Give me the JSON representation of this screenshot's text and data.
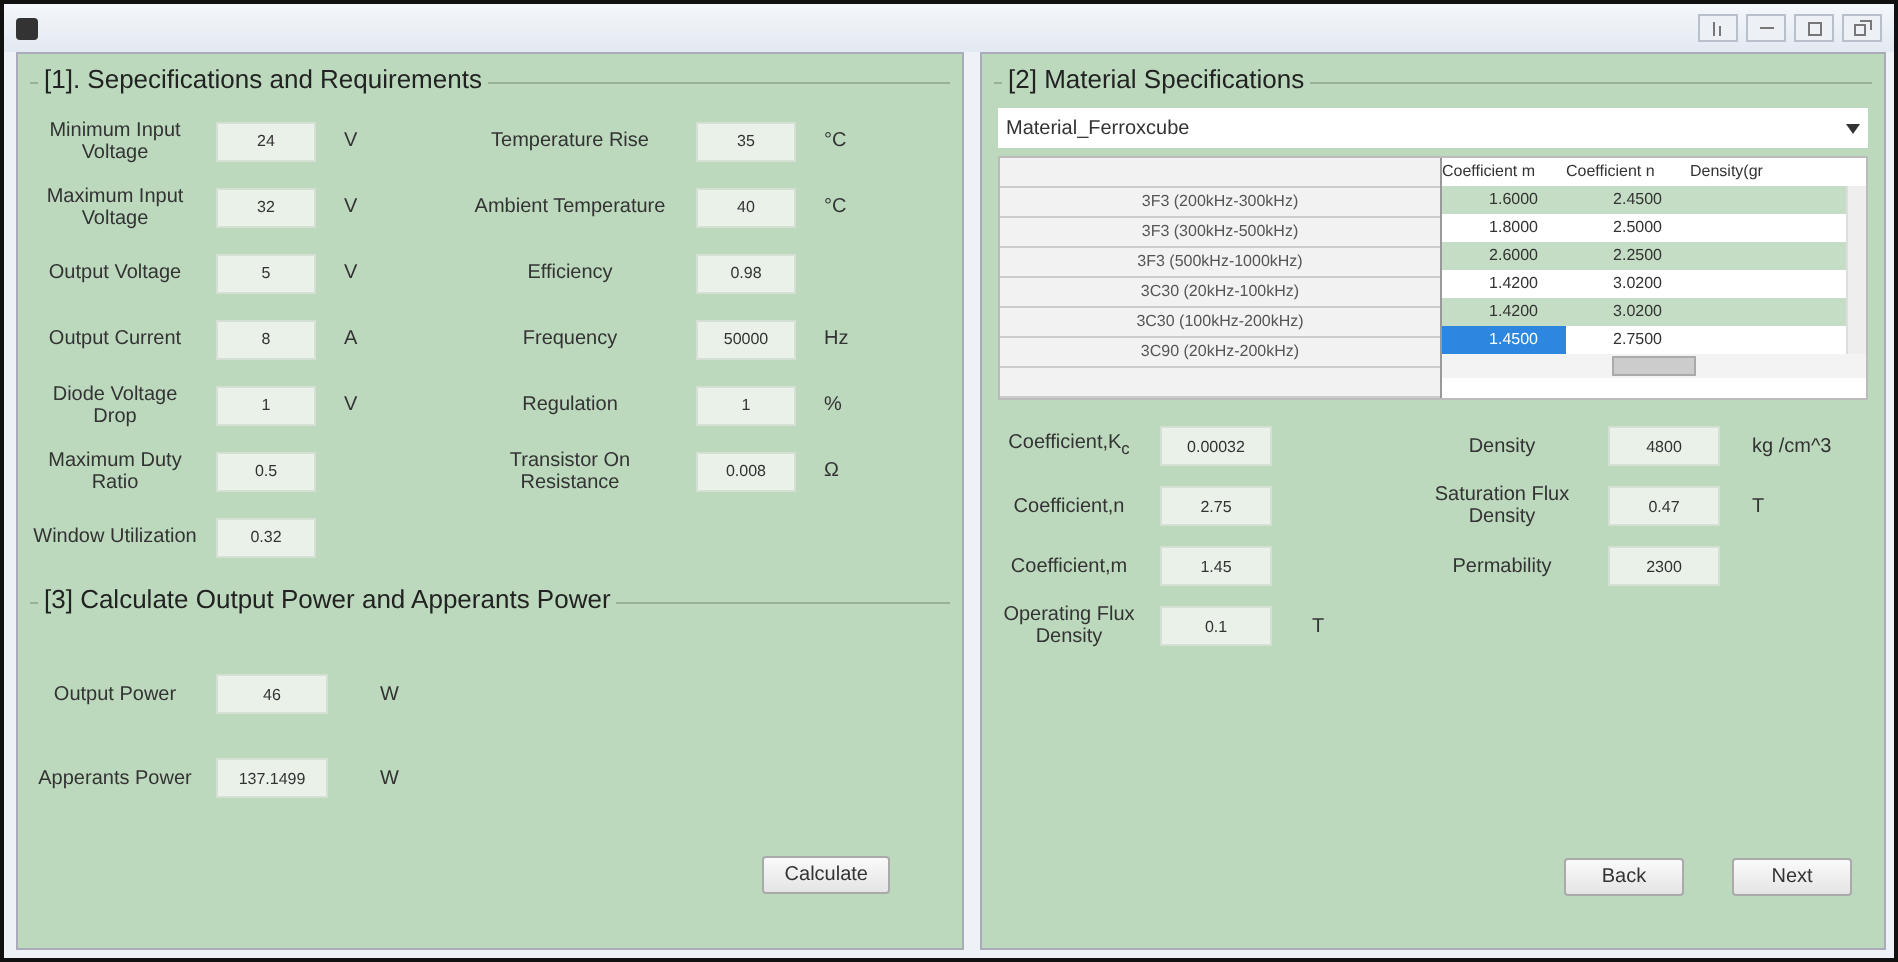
{
  "specifications": {
    "title": "[1]. Sepecifications and Requirements",
    "left_fields": [
      {
        "label": "Minimum Input Voltage",
        "value": "24",
        "unit": "V"
      },
      {
        "label": "Maximum Input Voltage",
        "value": "32",
        "unit": "V"
      },
      {
        "label": "Output Voltage",
        "value": "5",
        "unit": "V"
      },
      {
        "label": "Output Current",
        "value": "8",
        "unit": "A"
      },
      {
        "label": "Diode Voltage Drop",
        "value": "1",
        "unit": "V"
      },
      {
        "label": "Maximum Duty Ratio",
        "value": "0.5"
      },
      {
        "label": "Window Utilization",
        "value": "0.32"
      }
    ],
    "right_fields": [
      {
        "label": "Temperature Rise",
        "value": "35",
        "unit": "°C"
      },
      {
        "label": "Ambient Temperature",
        "value": "40",
        "unit": "°C"
      },
      {
        "label": "Efficiency",
        "value": "0.98"
      },
      {
        "label": "Frequency",
        "value": "50000",
        "unit": "Hz"
      },
      {
        "label": "Regulation",
        "value": "1",
        "unit": "%"
      },
      {
        "label": "Transistor On Resistance",
        "value": "0.008",
        "unit": "Ω"
      }
    ]
  },
  "power": {
    "title": "[3] Calculate Output Power and Apperants Power",
    "fields": [
      {
        "label": "Output Power",
        "value": "46",
        "unit": "W"
      },
      {
        "label": "Apperants Power",
        "value": "137.1499",
        "unit": "W"
      }
    ],
    "button": "Calculate"
  },
  "material": {
    "title": "[2] Material Specifications",
    "dropdown": "Material_Ferroxcube",
    "table": {
      "columns": [
        "Coefficient m",
        "Coefficient n",
        "Density(gr"
      ],
      "rows": [
        {
          "header": "3F3 (200kHz-300kHz)",
          "cells": [
            {
              "text": "1.6000",
              "selected": false
            },
            {
              "text": "2.4500",
              "selected": false
            }
          ]
        },
        {
          "header": "3F3 (300kHz-500kHz)",
          "cells": [
            {
              "text": "1.8000",
              "selected": false
            },
            {
              "text": "2.5000",
              "selected": false
            }
          ]
        },
        {
          "header": "3F3 (500kHz-1000kHz)",
          "cells": [
            {
              "text": "2.6000",
              "selected": false
            },
            {
              "text": "2.2500",
              "selected": false
            }
          ]
        },
        {
          "header": "3C30 (20kHz-100kHz)",
          "cells": [
            {
              "text": "1.4200",
              "selected": false
            },
            {
              "text": "3.0200",
              "selected": false
            }
          ]
        },
        {
          "header": "3C30 (100kHz-200kHz)",
          "cells": [
            {
              "text": "1.4200",
              "selected": false
            },
            {
              "text": "3.0200",
              "selected": false
            }
          ]
        },
        {
          "header": "3C90 (20kHz-200kHz)",
          "cells": [
            {
              "text": "1.4500",
              "selected": true
            },
            {
              "text": "2.7500",
              "selected": false
            }
          ]
        }
      ]
    },
    "left_fields": [
      {
        "label": "Coefficient,K$_{c}$",
        "value": "0.00032"
      },
      {
        "label": "Coefficient,n",
        "value": "2.75"
      },
      {
        "label": "Coefficient,m",
        "value": "1.45"
      },
      {
        "label": "Operating Flux Density",
        "value": "0.1",
        "unit": "T"
      }
    ],
    "right_fields": [
      {
        "label": "Density",
        "value": "4800",
        "unit": "kg /cm^3"
      },
      {
        "label": "Saturation Flux Density",
        "value": "0.47",
        "unit": "T"
      },
      {
        "label": "Permability",
        "value": "2300"
      }
    ],
    "buttons": [
      "Back",
      "Next"
    ]
  }
}
